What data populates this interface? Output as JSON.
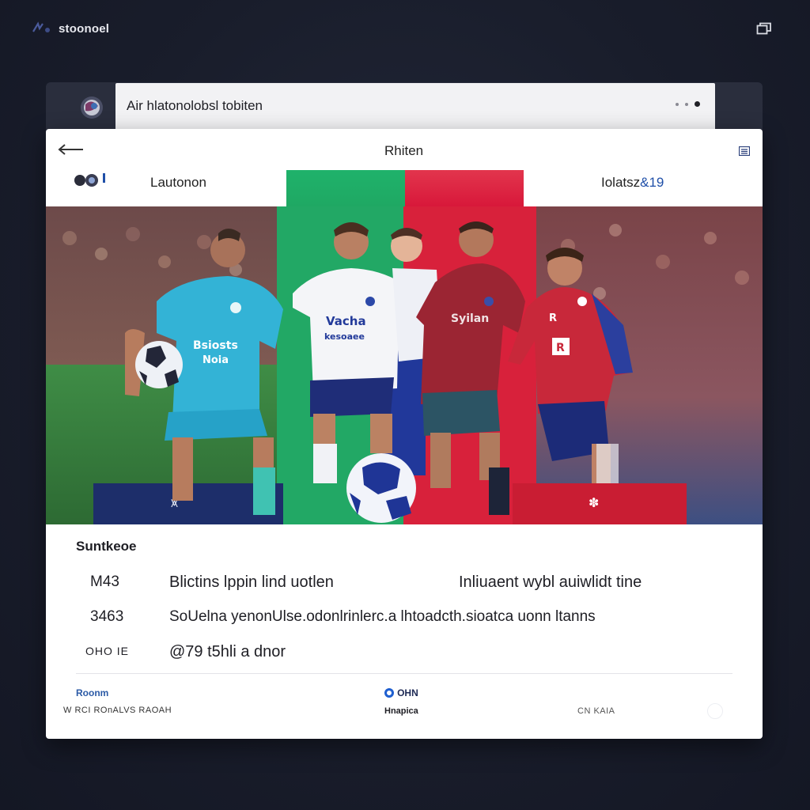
{
  "app": {
    "brand_label": "stoonoel",
    "brand_icon": "logo-glyph-icon",
    "window_icon": "window-restore-icon"
  },
  "back_card": {
    "title": "Air hlatonolobsl tobiten",
    "menu_icon": "more-dots-icon"
  },
  "card": {
    "title": "Rhiten",
    "back_icon": "back-arrow-icon",
    "menu_icon": "list-menu-icon",
    "left_team_label": "Lautonon",
    "right_team_label_main": "Iolatsz",
    "right_team_label_accent": "&19",
    "team_colors": [
      "#1fb26b",
      "#e21a3c"
    ]
  },
  "details": {
    "section_label": "Suntkeoe",
    "rows": [
      {
        "num": "M43",
        "text": "Blictins lppin lind uotlen",
        "text2": "Inliuaent wybl auiwlidt tine"
      },
      {
        "num": "3463",
        "text": "SoUelna yenonUlse.odonlrinlerc.a lhtoadcth.sioatca uonn ltanns",
        "text2": ""
      },
      {
        "num": "OHO IE",
        "text": "@79 t5hli a dnor",
        "text2": ""
      }
    ]
  },
  "footer": {
    "left_top": "Roonm",
    "left_bottom": "W RCI ROnALVS RAOAH",
    "mid_top": "OHN",
    "mid_bottom": "Hnapica",
    "right": "CN KAIA"
  }
}
